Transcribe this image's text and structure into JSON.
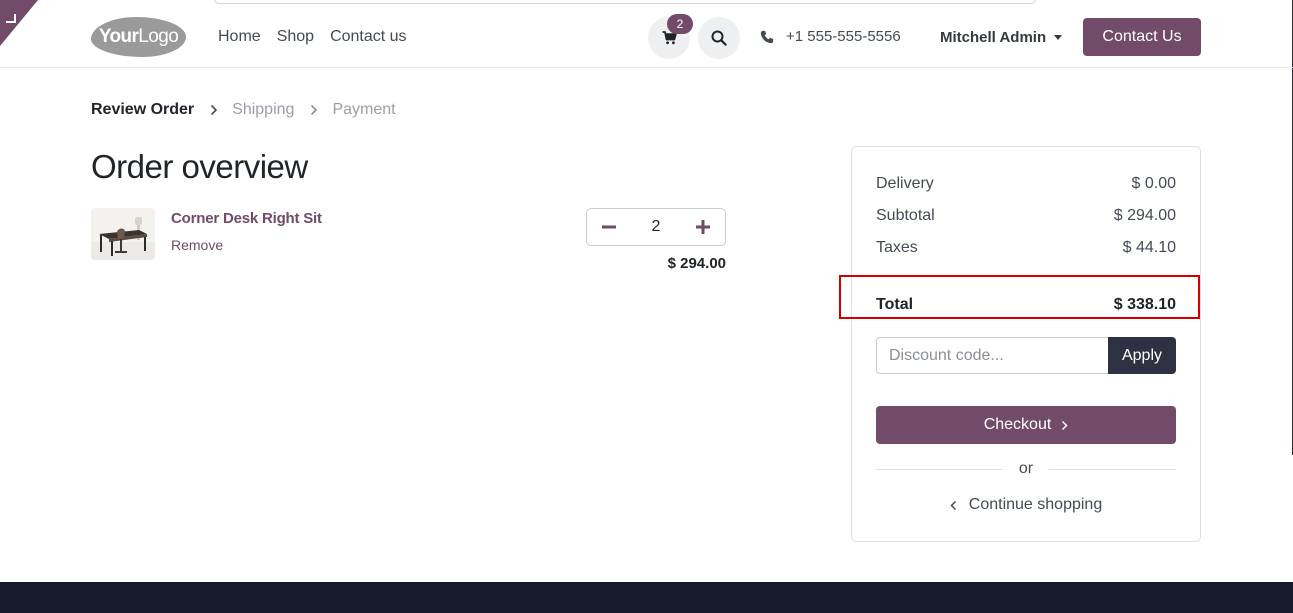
{
  "header": {
    "logo_bold": "Your",
    "logo_light": "Logo",
    "nav": [
      "Home",
      "Shop",
      "Contact us"
    ],
    "cart_count": "2",
    "phone": "+1 555-555-5556",
    "user": "Mitchell Admin",
    "contact_button": "Contact Us"
  },
  "steps": [
    "Review Order",
    "Shipping",
    "Payment"
  ],
  "main": {
    "title": "Order overview",
    "item": {
      "name": "Corner Desk Right Sit",
      "remove_label": "Remove",
      "quantity": "2",
      "price": "$ 294.00"
    }
  },
  "summary": {
    "delivery_label": "Delivery",
    "delivery_value": "$ 0.00",
    "subtotal_label": "Subtotal",
    "subtotal_value": "$ 294.00",
    "taxes_label": "Taxes",
    "taxes_value": "$ 44.10",
    "total_label": "Total",
    "total_value": "$ 338.10",
    "discount_placeholder": "Discount code...",
    "apply_label": "Apply",
    "checkout_label": "Checkout",
    "or_label": "or",
    "continue_label": "Continue shopping"
  },
  "colors": {
    "brand": "#714b67",
    "apply": "#2e3142",
    "highlight": "#d40000",
    "footer": "#151b2b"
  }
}
